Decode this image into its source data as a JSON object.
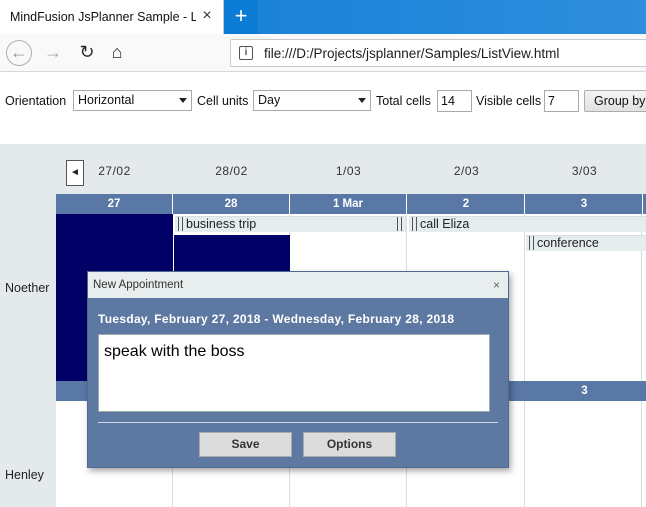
{
  "browser": {
    "tab_title": "MindFusion JsPlanner Sample - List",
    "tab_close": "×",
    "new_tab": "+",
    "back": "←",
    "forward": "→",
    "reload": "↻",
    "home": "⌂",
    "url": "file:///D:/Projects/jsplanner/Samples/ListView.html"
  },
  "toolbar": {
    "orientation_label": "Orientation",
    "orientation_value": "Horizontal",
    "cell_units_label": "Cell units",
    "cell_units_value": "Day",
    "total_cells_label": "Total cells",
    "total_cells_value": "14",
    "visible_cells_label": "Visible cells",
    "visible_cells_value": "7",
    "group_by_label": "Group by"
  },
  "calendar": {
    "scroll_left": "◄",
    "dates": [
      "27/02",
      "28/02",
      "1/03",
      "2/03",
      "3/03"
    ],
    "days": [
      "27",
      "28",
      "1 Mar",
      "2",
      "3"
    ],
    "resources": [
      "Noether",
      "Henley"
    ],
    "second_row_day": "3",
    "appointments": [
      {
        "label": "business trip"
      },
      {
        "label": "call Eliza"
      },
      {
        "label": "conference"
      }
    ]
  },
  "dialog": {
    "title": "New Appointment",
    "close": "×",
    "range": "Tuesday, February 27, 2018 - Wednesday, February 28, 2018",
    "subject": "speak with the boss",
    "save_label": "Save",
    "options_label": "Options"
  },
  "colors": {
    "header_blue": "#5978a6",
    "selection": "#000066",
    "dialog_bg": "#5e79a1"
  }
}
